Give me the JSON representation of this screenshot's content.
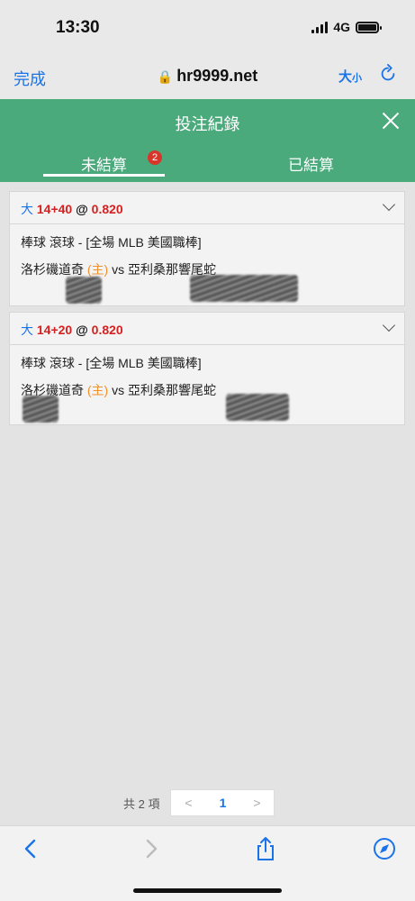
{
  "status": {
    "time": "13:30",
    "network": "4G"
  },
  "browser": {
    "done_label": "完成",
    "url": "hr9999.net",
    "textsize_big": "大",
    "textsize_small": "小"
  },
  "header": {
    "title": "投注紀錄"
  },
  "tabs": [
    {
      "label": "未結算",
      "badge": "2"
    },
    {
      "label": "已結算"
    }
  ],
  "bets": [
    {
      "side": "大",
      "line": "14+40",
      "at": "@",
      "odds": "0.820",
      "market": "棒球 滾球 - [全場 MLB 美國職棒]",
      "home": "洛杉磯道奇",
      "home_tag": "(主)",
      "vs": "vs",
      "away": "亞利桑那響尾蛇"
    },
    {
      "side": "大",
      "line": "14+20",
      "at": "@",
      "odds": "0.820",
      "market": "棒球 滾球 - [全場 MLB 美國職棒]",
      "home": "洛杉磯道奇",
      "home_tag": "(主)",
      "vs": "vs",
      "away": "亞利桑那響尾蛇"
    }
  ],
  "pagination": {
    "total": "共 2 項",
    "prev": "<",
    "current": "1",
    "next": ">"
  },
  "colors": {
    "header_green": "#4aaa7c",
    "badge_red": "#d9362b",
    "link_blue": "#1a73e8",
    "odds_red": "#d62020",
    "home_orange": "#f0912b"
  }
}
